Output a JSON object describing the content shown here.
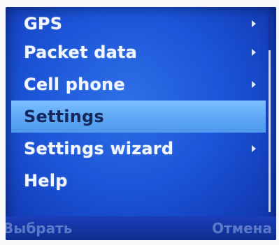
{
  "menu": {
    "items": [
      {
        "label": "GPS",
        "has_submenu": true
      },
      {
        "label": "Packet data",
        "has_submenu": true
      },
      {
        "label": "Cell phone",
        "has_submenu": true
      },
      {
        "label": "Settings",
        "has_submenu": false,
        "selected": true
      },
      {
        "label": "Settings wizard",
        "has_submenu": true
      },
      {
        "label": "Help",
        "has_submenu": false
      }
    ]
  },
  "softkeys": {
    "left_label": "Выбрать",
    "right_label": "Отмена"
  },
  "colors": {
    "background": "#1c55d8",
    "highlight": "#5fa9f6",
    "text": "#f2f6ff"
  }
}
